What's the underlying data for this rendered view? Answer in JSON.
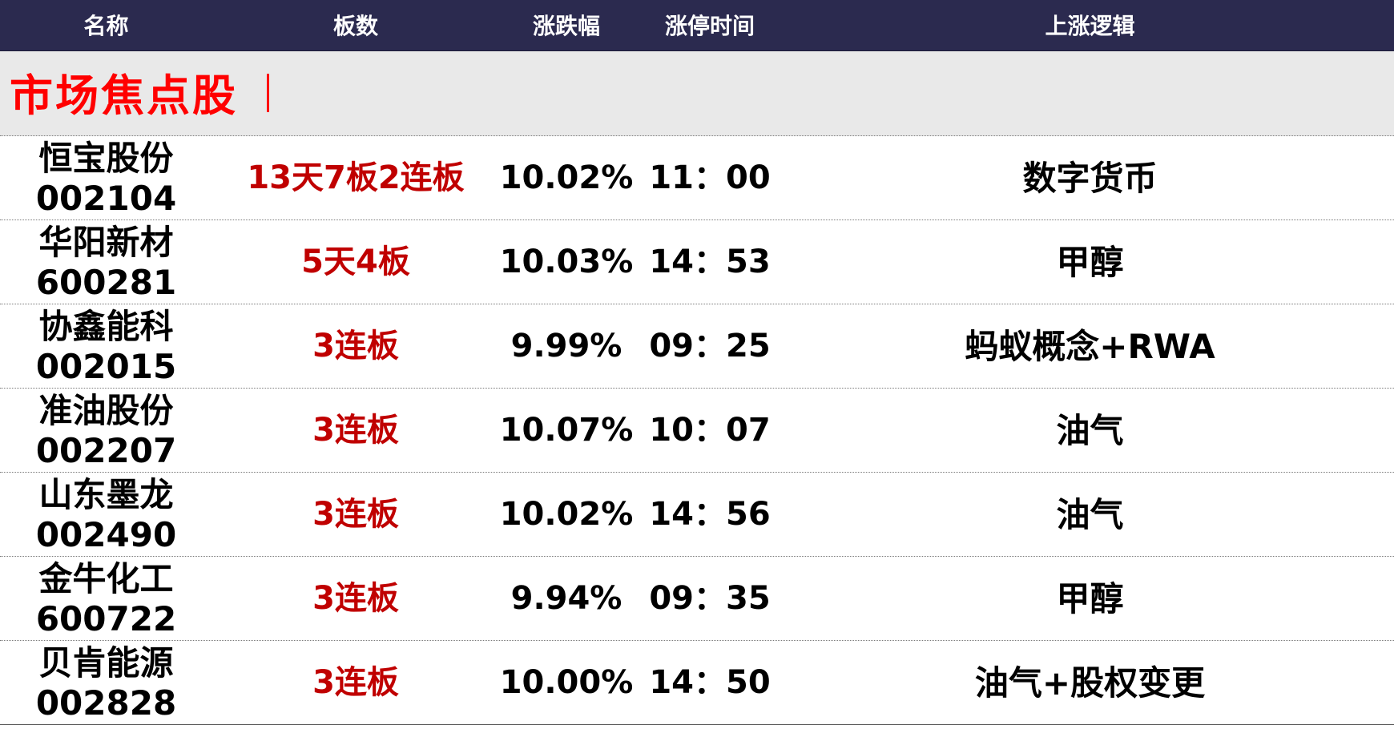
{
  "header": {
    "name": "名称",
    "boards": "板数",
    "change": "涨跌幅",
    "limit_time": "涨停时间",
    "logic": "上涨逻辑"
  },
  "section": {
    "title": "市场焦点股"
  },
  "colors": {
    "header_bg": "#2b2a4f",
    "section_bg": "#e9e9e9",
    "section_title": "#ff0000",
    "boards_text": "#c00000"
  },
  "rows": [
    {
      "name": "恒宝股份",
      "code": "002104",
      "boards": "13天7板2连板",
      "change": "10.02%",
      "time": "11：00",
      "logic": "数字货币"
    },
    {
      "name": "华阳新材",
      "code": "600281",
      "boards": "5天4板",
      "change": "10.03%",
      "time": "14：53",
      "logic": "甲醇"
    },
    {
      "name": "协鑫能科",
      "code": "002015",
      "boards": "3连板",
      "change": "9.99%",
      "time": "09：25",
      "logic": "蚂蚁概念+RWA"
    },
    {
      "name": "准油股份",
      "code": "002207",
      "boards": "3连板",
      "change": "10.07%",
      "time": "10：07",
      "logic": "油气"
    },
    {
      "name": "山东墨龙",
      "code": "002490",
      "boards": "3连板",
      "change": "10.02%",
      "time": "14：56",
      "logic": "油气"
    },
    {
      "name": "金牛化工",
      "code": "600722",
      "boards": "3连板",
      "change": "9.94%",
      "time": "09：35",
      "logic": "甲醇"
    },
    {
      "name": "贝肯能源",
      "code": "002828",
      "boards": "3连板",
      "change": "10.00%",
      "time": "14：50",
      "logic": "油气+股权变更"
    }
  ]
}
